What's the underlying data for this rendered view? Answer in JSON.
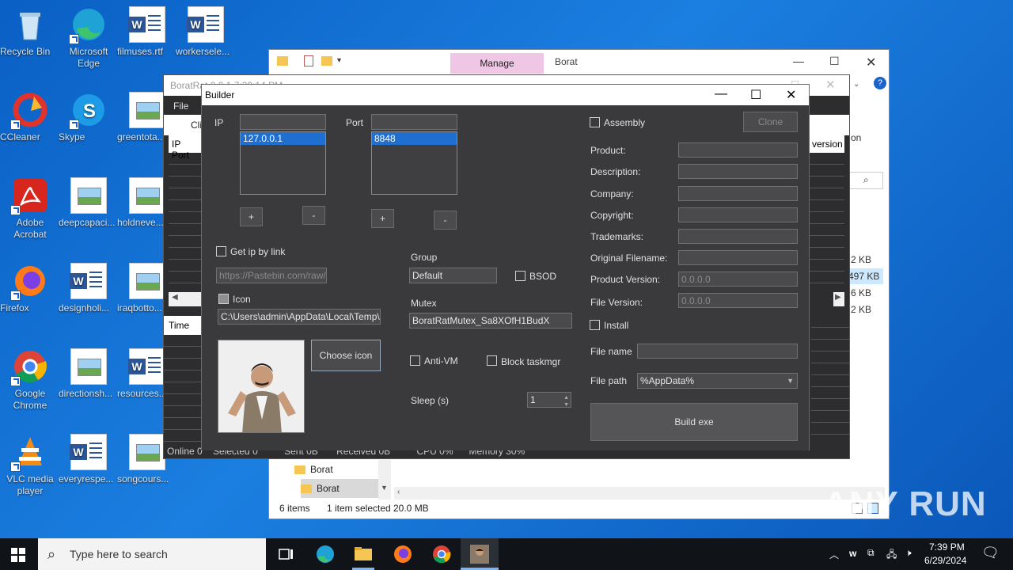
{
  "desktop": {
    "icons": [
      {
        "label": "Recycle Bin"
      },
      {
        "label": "Microsoft Edge"
      },
      {
        "label": "filmuses.rtf"
      },
      {
        "label": "workersele..."
      },
      {
        "label": "CCleaner"
      },
      {
        "label": "Skype"
      },
      {
        "label": "greentota..."
      },
      {
        "label": "Adobe Acrobat"
      },
      {
        "label": "deepcapaci..."
      },
      {
        "label": "holdneve..."
      },
      {
        "label": "Firefox"
      },
      {
        "label": "designholi..."
      },
      {
        "label": "iraqbotto..."
      },
      {
        "label": "Google Chrome"
      },
      {
        "label": "directionsh..."
      },
      {
        "label": "resources..."
      },
      {
        "label": "VLC media player"
      },
      {
        "label": "everyrespe..."
      },
      {
        "label": "songcours..."
      }
    ]
  },
  "explorer": {
    "manage_tab": "Manage",
    "title": "Borat",
    "sizes": [
      "2 KB",
      "497 KB",
      "6 KB",
      "2 KB"
    ],
    "nav_items": [
      "Borat",
      "Borat"
    ],
    "status": {
      "items": "6 items",
      "selected": "1 item selected",
      "size": "20.0 MB"
    }
  },
  "ratwin": {
    "title": "BoratRat 0.0.1   7:39:14 PM",
    "menu_file": "File",
    "col_ip_port": "IP Port",
    "col_version": "version",
    "col_time": "Time",
    "status": "Online 0    Selected 0          Sent 0B       Received 0B          CPU 0%      Memory 30%"
  },
  "builder": {
    "title": "Builder",
    "ip_label": "IP",
    "ip_input": "",
    "ip_list": [
      "127.0.0.1"
    ],
    "port_label": "Port",
    "port_input": "",
    "port_list": [
      "8848"
    ],
    "plus": "+",
    "minus": "-",
    "get_ip_by_link": "Get ip by link",
    "pastebin_placeholder": "https://Pastebin.com/raw/fe",
    "icon_label": "Icon",
    "icon_path": "C:\\Users\\admin\\AppData\\Local\\Temp\\Im",
    "choose_icon": "Choose icon",
    "group_label": "Group",
    "group_value": "Default",
    "bsod_label": "BSOD",
    "mutex_label": "Mutex",
    "mutex_value": "BoratRatMutex_Sa8XOfH1BudX",
    "antivm_label": "Anti-VM",
    "block_taskmgr_label": "Block taskmgr",
    "sleep_label": "Sleep (s)",
    "sleep_value": "1",
    "assembly_label": "Assembly",
    "clone_label": "Clone",
    "assembly_fields": [
      {
        "label": "Product:",
        "value": ""
      },
      {
        "label": "Description:",
        "value": ""
      },
      {
        "label": "Company:",
        "value": ""
      },
      {
        "label": "Copyright:",
        "value": ""
      },
      {
        "label": "Trademarks:",
        "value": ""
      },
      {
        "label": "Original Filename:",
        "value": ""
      },
      {
        "label": "Product Version:",
        "value": "0.0.0.0"
      },
      {
        "label": "File Version:",
        "value": "0.0.0.0"
      }
    ],
    "install_label": "Install",
    "file_name_label": "File name",
    "file_name_value": "",
    "file_path_label": "File path",
    "file_path_value": "%AppData%",
    "build_label": "Build exe"
  },
  "taskbar": {
    "search_placeholder": "Type here to search",
    "time": "7:39 PM",
    "date": "6/29/2024"
  },
  "watermark": "ANY RUN"
}
